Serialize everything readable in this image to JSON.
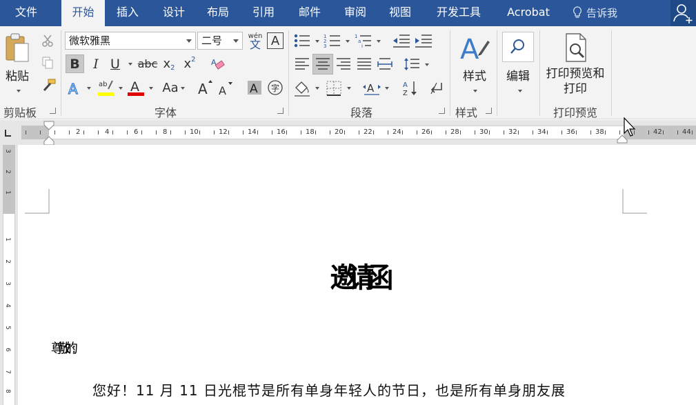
{
  "tabs": [
    {
      "label": "文件",
      "active": false
    },
    {
      "label": "开始",
      "active": true
    },
    {
      "label": "插入",
      "active": false
    },
    {
      "label": "设计",
      "active": false
    },
    {
      "label": "布局",
      "active": false
    },
    {
      "label": "引用",
      "active": false
    },
    {
      "label": "邮件",
      "active": false
    },
    {
      "label": "审阅",
      "active": false
    },
    {
      "label": "视图",
      "active": false
    },
    {
      "label": "开发工具",
      "active": false
    },
    {
      "label": "Acrobat",
      "active": false
    }
  ],
  "tell_me": "告诉我",
  "ribbon": {
    "clipboard": {
      "paste_label": "粘贴",
      "group_label": "剪贴板"
    },
    "font": {
      "font_name": "微软雅黑",
      "font_size": "二号",
      "phonetic_label": "wén",
      "phonetic_char": "文",
      "bold": "B",
      "italic": "I",
      "underline": "U",
      "strike": "abc",
      "subscript": "x",
      "superscript": "x",
      "sub_mark": "2",
      "sup_mark": "2",
      "case_label": "Aa",
      "group_label": "字体",
      "highlight_color": "#ffff00",
      "font_color": "#e00000"
    },
    "paragraph": {
      "group_label": "段落"
    },
    "styles": {
      "label": "样式",
      "group_label": "样式"
    },
    "editing": {
      "label": "编辑"
    },
    "print": {
      "label_line1": "打印预览和",
      "label_line2": "打印",
      "group_label": "打印预览"
    }
  },
  "ruler": {
    "numbers": [
      "2",
      "4",
      "6",
      "8",
      "10",
      "12",
      "14",
      "16",
      "18",
      "20",
      "22",
      "24",
      "26",
      "28",
      "30",
      "32",
      "34",
      "36",
      "38",
      "42",
      "44"
    ],
    "vertical_numbers": [
      "3",
      "2",
      "1",
      "1",
      "2",
      "3",
      "4",
      "5",
      "6",
      "7",
      "8"
    ]
  },
  "document": {
    "title": "邀请函",
    "salutation": "尊敬的:",
    "body": "您好！11 月 11 日光棍节是所有单身年轻人的节日，也是所有单身朋友展"
  },
  "colors": {
    "accent": "#2b579a",
    "ribbon_bg": "#f3f3f3"
  }
}
